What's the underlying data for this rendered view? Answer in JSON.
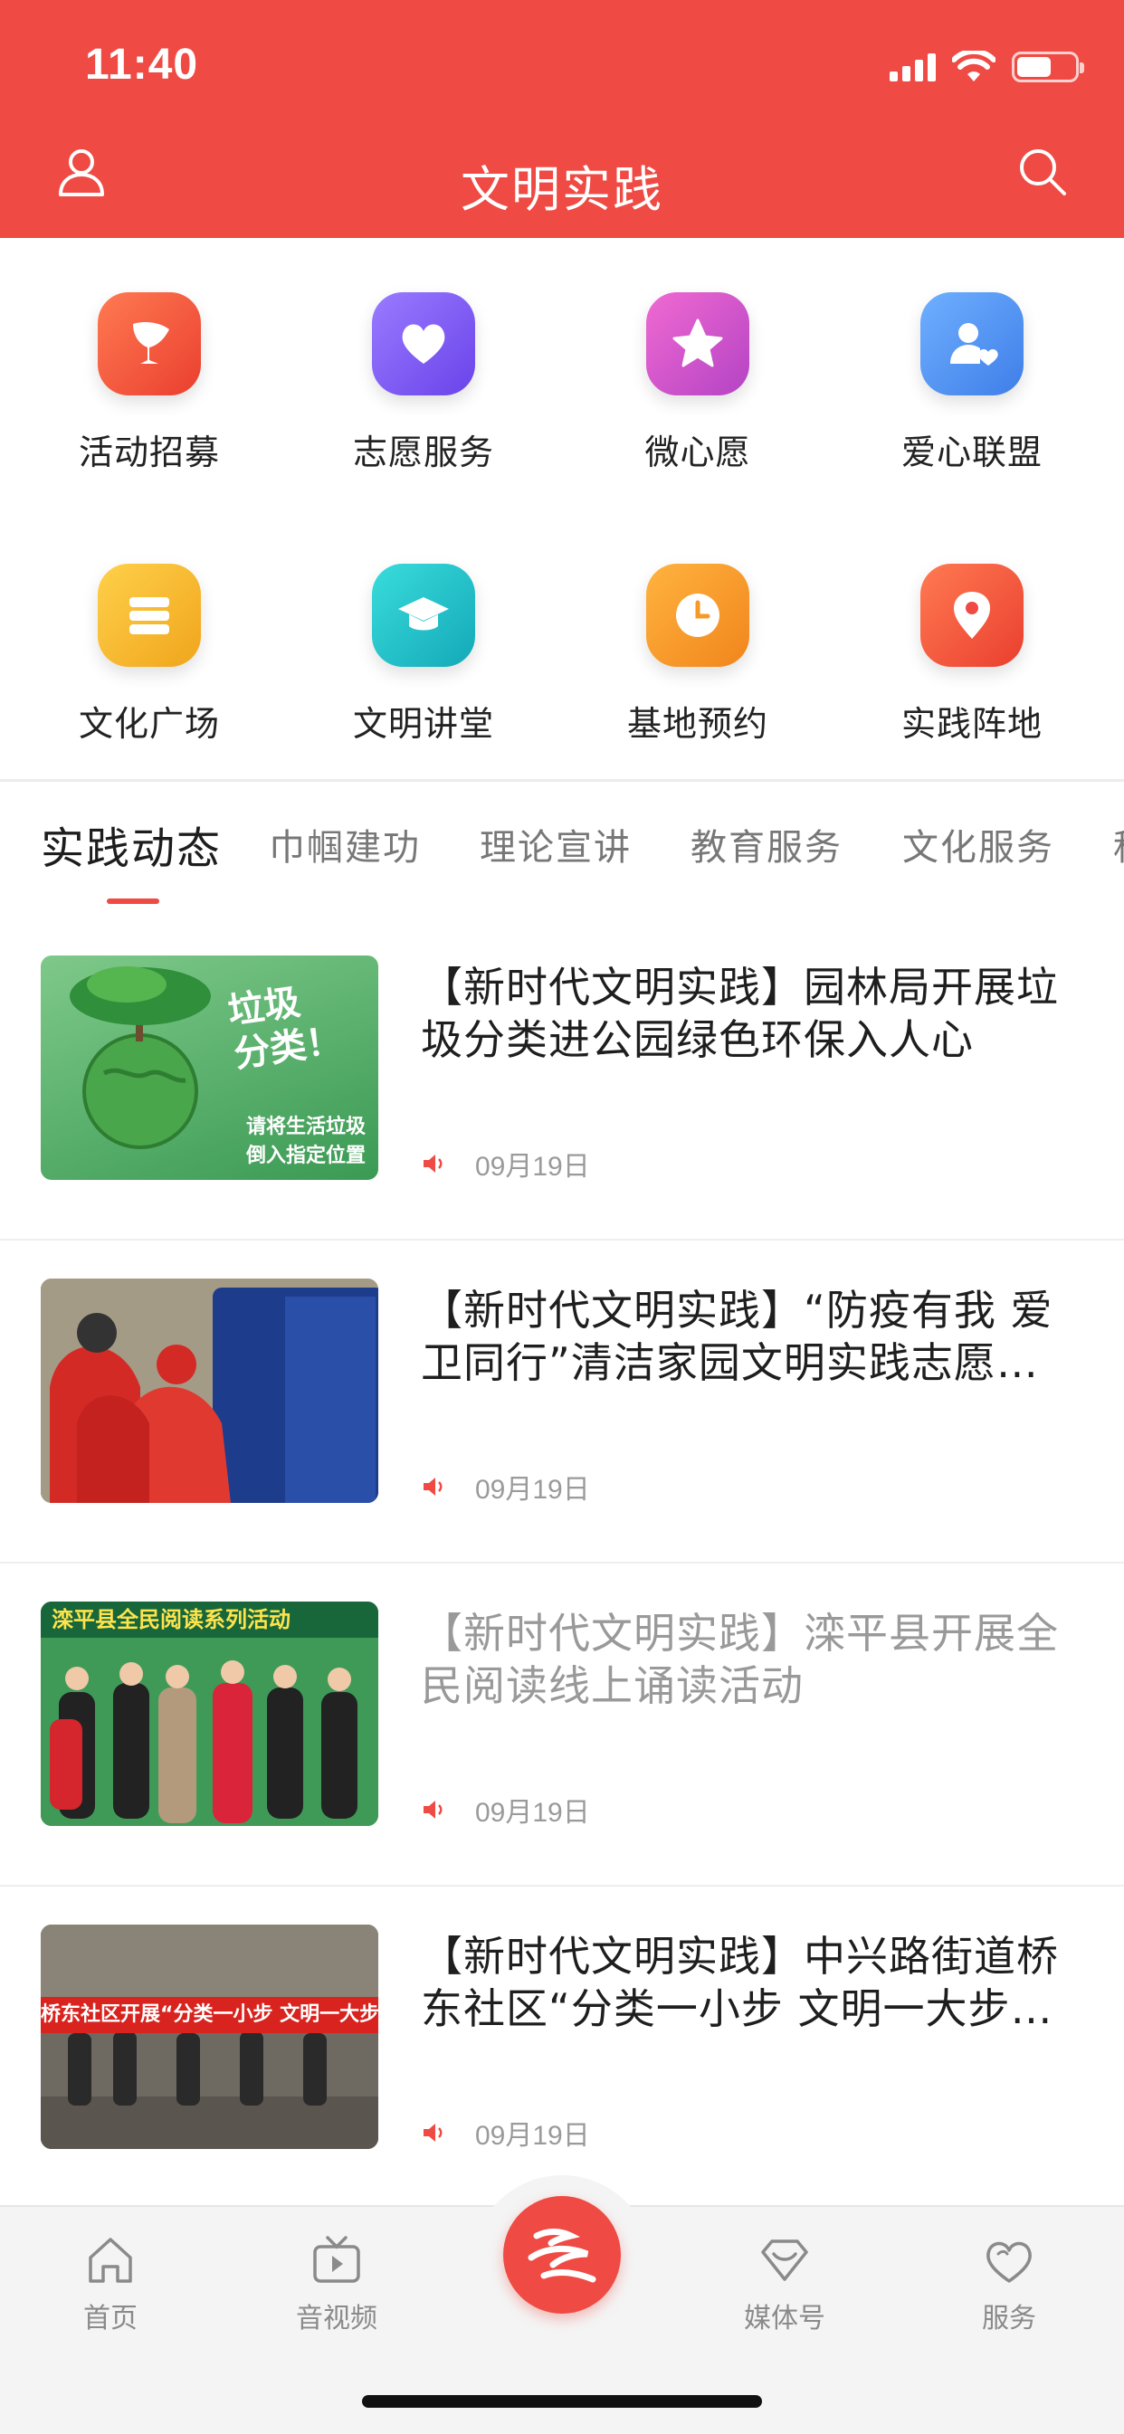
{
  "status_bar": {
    "time": "11:40",
    "battery_level": 0.6
  },
  "header": {
    "title": "文明实践",
    "user_icon": "user-icon",
    "search_icon": "search-icon"
  },
  "grid": [
    {
      "label": "活动招募",
      "icon": "trophy-icon",
      "color": "#f05a3e"
    },
    {
      "label": "志愿服务",
      "icon": "heart-icon",
      "color": "#7c5cf2"
    },
    {
      "label": "微心愿",
      "icon": "star-icon",
      "color": "#d94fc0"
    },
    {
      "label": "爱心联盟",
      "icon": "person-heart-icon",
      "color": "#4e8ff0"
    },
    {
      "label": "文化广场",
      "icon": "books-icon",
      "color": "#f4b427"
    },
    {
      "label": "文明讲堂",
      "icon": "graduation-cap-icon",
      "color": "#1fc2c6"
    },
    {
      "label": "基地预约",
      "icon": "clock-icon",
      "color": "#f69a25"
    },
    {
      "label": "实践阵地",
      "icon": "location-pin-icon",
      "color": "#f05a3e"
    }
  ],
  "tabs": [
    "实践动态",
    "巾帼建功",
    "理论宣讲",
    "教育服务",
    "文化服务",
    "科"
  ],
  "news": [
    {
      "title": "【新时代文明实践】园林局开展垃圾分类进公园绿色环保入人心",
      "date": "09月19日",
      "read": false,
      "thumb_text_1": "垃圾",
      "thumb_text_2": "分类！",
      "thumb_text_3": "请将生活垃圾",
      "thumb_text_4": "倒入指定位置"
    },
    {
      "title": "【新时代文明实践】“防疫有我 爱卫同行”清洁家园文明实践志愿…",
      "date": "09月19日",
      "read": false
    },
    {
      "title": "【新时代文明实践】滦平县开展全民阅读线上诵读活动",
      "date": "09月19日",
      "read": true,
      "thumb_text_1": "滦平县全民阅读系列活动"
    },
    {
      "title": "【新时代文明实践】中兴路街道桥东社区“分类一小步 文明一大步…",
      "date": "09月19日",
      "read": false,
      "thumb_text_1": "桥东社区开展“分类一小步 文明一大步”垃圾分类志愿宣传"
    }
  ],
  "bottom_nav": [
    {
      "label": "首页",
      "icon": "home-icon"
    },
    {
      "label": "音视频",
      "icon": "video-icon"
    },
    {
      "label": "",
      "icon": "brand-logo-icon"
    },
    {
      "label": "媒体号",
      "icon": "media-diamond-icon"
    },
    {
      "label": "服务",
      "icon": "service-heart-icon"
    }
  ],
  "colors": {
    "brand": "#ef4a43",
    "tab_active": "#1d1d1d",
    "tab_inactive": "#777777"
  }
}
